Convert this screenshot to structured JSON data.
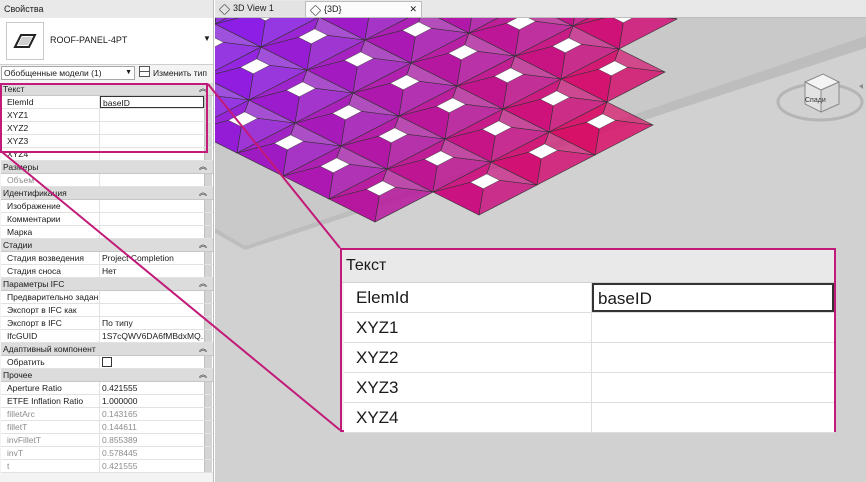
{
  "properties": {
    "title": "Свойства",
    "type_name": "ROOF-PANEL-4PT",
    "filter": "Обобщенные модели (1)",
    "edit_type_label": "Изменить тип",
    "groups": [
      {
        "name": "Текст",
        "rows": [
          {
            "name": "ElemId",
            "value": "baseID"
          },
          {
            "name": "XYZ1",
            "value": ""
          },
          {
            "name": "XYZ2",
            "value": ""
          },
          {
            "name": "XYZ3",
            "value": ""
          },
          {
            "name": "XYZ4",
            "value": ""
          }
        ]
      },
      {
        "name": "Размеры",
        "rows": [
          {
            "name": "Объем",
            "value": ""
          }
        ]
      },
      {
        "name": "Идентификация",
        "rows": [
          {
            "name": "Изображение",
            "value": ""
          },
          {
            "name": "Комментарии",
            "value": ""
          },
          {
            "name": "Марка",
            "value": ""
          }
        ]
      },
      {
        "name": "Стадии",
        "rows": [
          {
            "name": "Стадия возведения",
            "value": "Project Completion"
          },
          {
            "name": "Стадия сноса",
            "value": "Нет"
          }
        ]
      },
      {
        "name": "Параметры IFC",
        "rows": [
          {
            "name": "Предварительно задан...",
            "value": ""
          },
          {
            "name": "Экспорт в IFC как",
            "value": ""
          },
          {
            "name": "Экспорт в IFC",
            "value": "По типу"
          },
          {
            "name": "IfcGUID",
            "value": "1S7cQWV6DA6fMBdxMQ..."
          }
        ]
      },
      {
        "name": "Адаптивный компонент",
        "rows": [
          {
            "name": "Обратить",
            "value": ""
          }
        ]
      },
      {
        "name": "Прочее",
        "rows": [
          {
            "name": "Aperture Ratio",
            "value": "0.421555"
          },
          {
            "name": "ETFE Inflation Ratio",
            "value": "1.000000"
          },
          {
            "name": "filletArc",
            "value": "0.143165"
          },
          {
            "name": "filletT",
            "value": "0.144611"
          },
          {
            "name": "invFilletT",
            "value": "0.855389"
          },
          {
            "name": "invT",
            "value": "0.578445"
          },
          {
            "name": "t",
            "value": "0.421555"
          }
        ]
      }
    ]
  },
  "tabs": [
    {
      "label": "3D View 1"
    },
    {
      "label": "{3D}"
    }
  ],
  "viewcube": {
    "label": "Спади"
  },
  "zoom": {
    "group": "Текст",
    "rows": [
      {
        "name": "ElemId",
        "value": "baseID"
      },
      {
        "name": "XYZ1",
        "value": ""
      },
      {
        "name": "XYZ2",
        "value": ""
      },
      {
        "name": "XYZ3",
        "value": ""
      },
      {
        "name": "XYZ4",
        "value": ""
      }
    ]
  },
  "colors": {
    "accent": "#c21a78",
    "panel": "#f3f3f3",
    "viewport_bg": "#d1d1d1"
  }
}
